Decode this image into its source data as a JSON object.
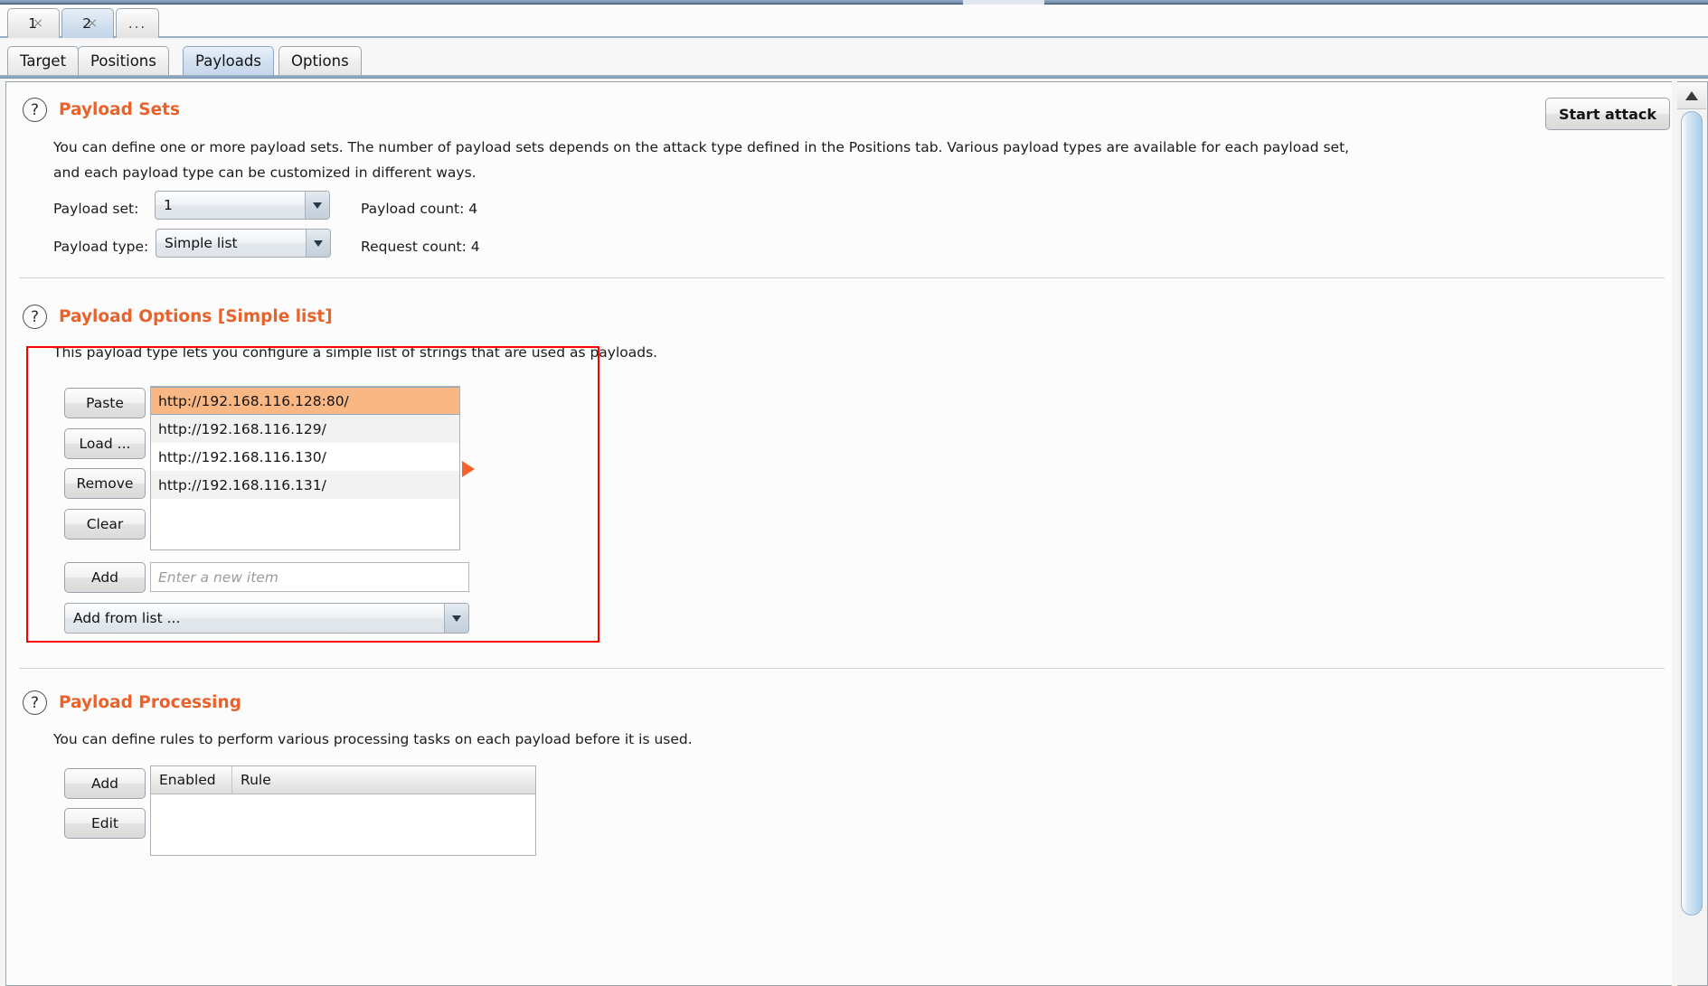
{
  "window": {
    "attack_tabs": [
      {
        "label": "1",
        "close": "×",
        "selected": false
      },
      {
        "label": "2",
        "close": "×",
        "selected": true
      }
    ],
    "overflow_tab": "...",
    "inner_tabs": [
      {
        "label": "Target",
        "selected": false
      },
      {
        "label": "Positions",
        "selected": false
      },
      {
        "label": "Payloads",
        "selected": true
      },
      {
        "label": "Options",
        "selected": false
      }
    ]
  },
  "toolbar": {
    "start_attack_label": "Start attack"
  },
  "colors": {
    "accent_heading": "#e8622c",
    "selection_highlight": "#f9b784",
    "marker_triangle": "#f4622a",
    "annotation_box": "#ff0000",
    "tab_selected": "#c6d7ea"
  },
  "payload_sets": {
    "help_icon": "question-mark-icon",
    "heading": "Payload Sets",
    "description_line1": "You can define one or more payload sets. The number of payload sets depends on the attack type defined in the Positions tab. Various payload types are available for each payload set,",
    "description_line2": "and each payload type can be customized in different ways.",
    "payload_set_label": "Payload set:",
    "payload_set_value": "1",
    "payload_type_label": "Payload type:",
    "payload_type_value": "Simple list",
    "payload_count_label": "Payload count:  4",
    "request_count_label": "Request count:  4"
  },
  "payload_options": {
    "help_icon": "question-mark-icon",
    "heading": "Payload Options [Simple list]",
    "description": "This payload type lets you configure a simple list of strings that are used as payloads.",
    "buttons": [
      {
        "label": "Paste"
      },
      {
        "label": "Load ..."
      },
      {
        "label": "Remove"
      },
      {
        "label": "Clear"
      }
    ],
    "items": [
      "http://192.168.116.128:80/",
      "http://192.168.116.129/",
      "http://192.168.116.130/",
      "http://192.168.116.131/"
    ],
    "selected_index": 0,
    "add_button_label": "Add",
    "add_input_value": "",
    "add_input_placeholder": "Enter a new item",
    "add_from_list_value": "Add from list ..."
  },
  "payload_processing": {
    "help_icon": "question-mark-icon",
    "heading": "Payload Processing",
    "description": "You can define rules to perform various processing tasks on each payload before it is used.",
    "buttons": [
      {
        "label": "Add"
      },
      {
        "label": "Edit"
      }
    ],
    "table_columns": [
      "Enabled",
      "Rule"
    ],
    "table_rows": []
  }
}
